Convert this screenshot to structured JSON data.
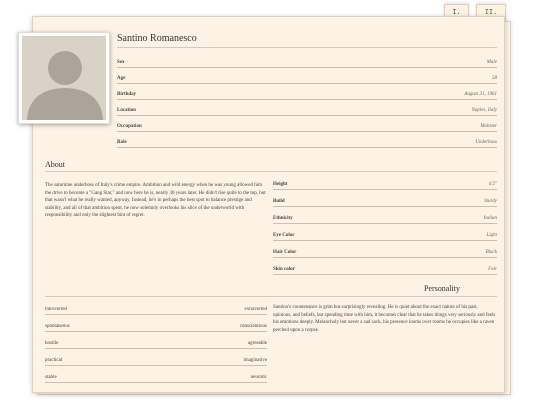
{
  "tabs": [
    {
      "label": "I."
    },
    {
      "label": "II."
    }
  ],
  "character": {
    "name": "Santino Romanesco",
    "portrait_icon": "person-silhouette-icon"
  },
  "info": [
    {
      "label": "Sex",
      "value": "Male"
    },
    {
      "label": "Age",
      "value": "58"
    },
    {
      "label": "Birthday",
      "value": "August 31, 1961"
    },
    {
      "label": "Location",
      "value": "Naples, Italy"
    },
    {
      "label": "Occupation",
      "value": "Mobster"
    },
    {
      "label": "Role",
      "value": "Underboss"
    }
  ],
  "about": {
    "title": "About",
    "text": "The saturnine underboss of Italy's crime empire. Ambition and wild energy when he was young allowed him the drive to become a \"Gang Star,\" and now here he is, nearly 30 years later. He didn't rise quite to the top, but that wasn't what he really wanted, anyway. Instead, he's in perhaps the best spot to balance prestige and stability, and all of that ambition spent, he now solemnly overlooks his slice of the underworld with responsibility and only the slightest hint of regret."
  },
  "attributes": [
    {
      "label": "Height",
      "value": "6'2\""
    },
    {
      "label": "Build",
      "value": "Sturdy"
    },
    {
      "label": "Ethnicity",
      "value": "Italian"
    },
    {
      "label": "Eye Color",
      "value": "Light"
    },
    {
      "label": "Hair Color",
      "value": "Black"
    },
    {
      "label": "Skin color",
      "value": "Fair"
    }
  ],
  "personality": {
    "title": "Personality",
    "traits": [
      {
        "left": "introverted",
        "right": "extraverted"
      },
      {
        "left": "spontaneous",
        "right": "conscientious"
      },
      {
        "left": "hostile",
        "right": "agreeable"
      },
      {
        "left": "practical",
        "right": "imaginative"
      },
      {
        "left": "stable",
        "right": "neurotic"
      }
    ],
    "text": "Santino's countenance is grim but surprisingly revealing. He is quiet about the exact nature of his past, opinions, and beliefs, but spending time with him, it becomes clear that he takes things very seriously and feels his emotions deeply. Melancholy but never a sad sack, his presence looms over rooms he occupies like a raven perched upon a corpse."
  }
}
